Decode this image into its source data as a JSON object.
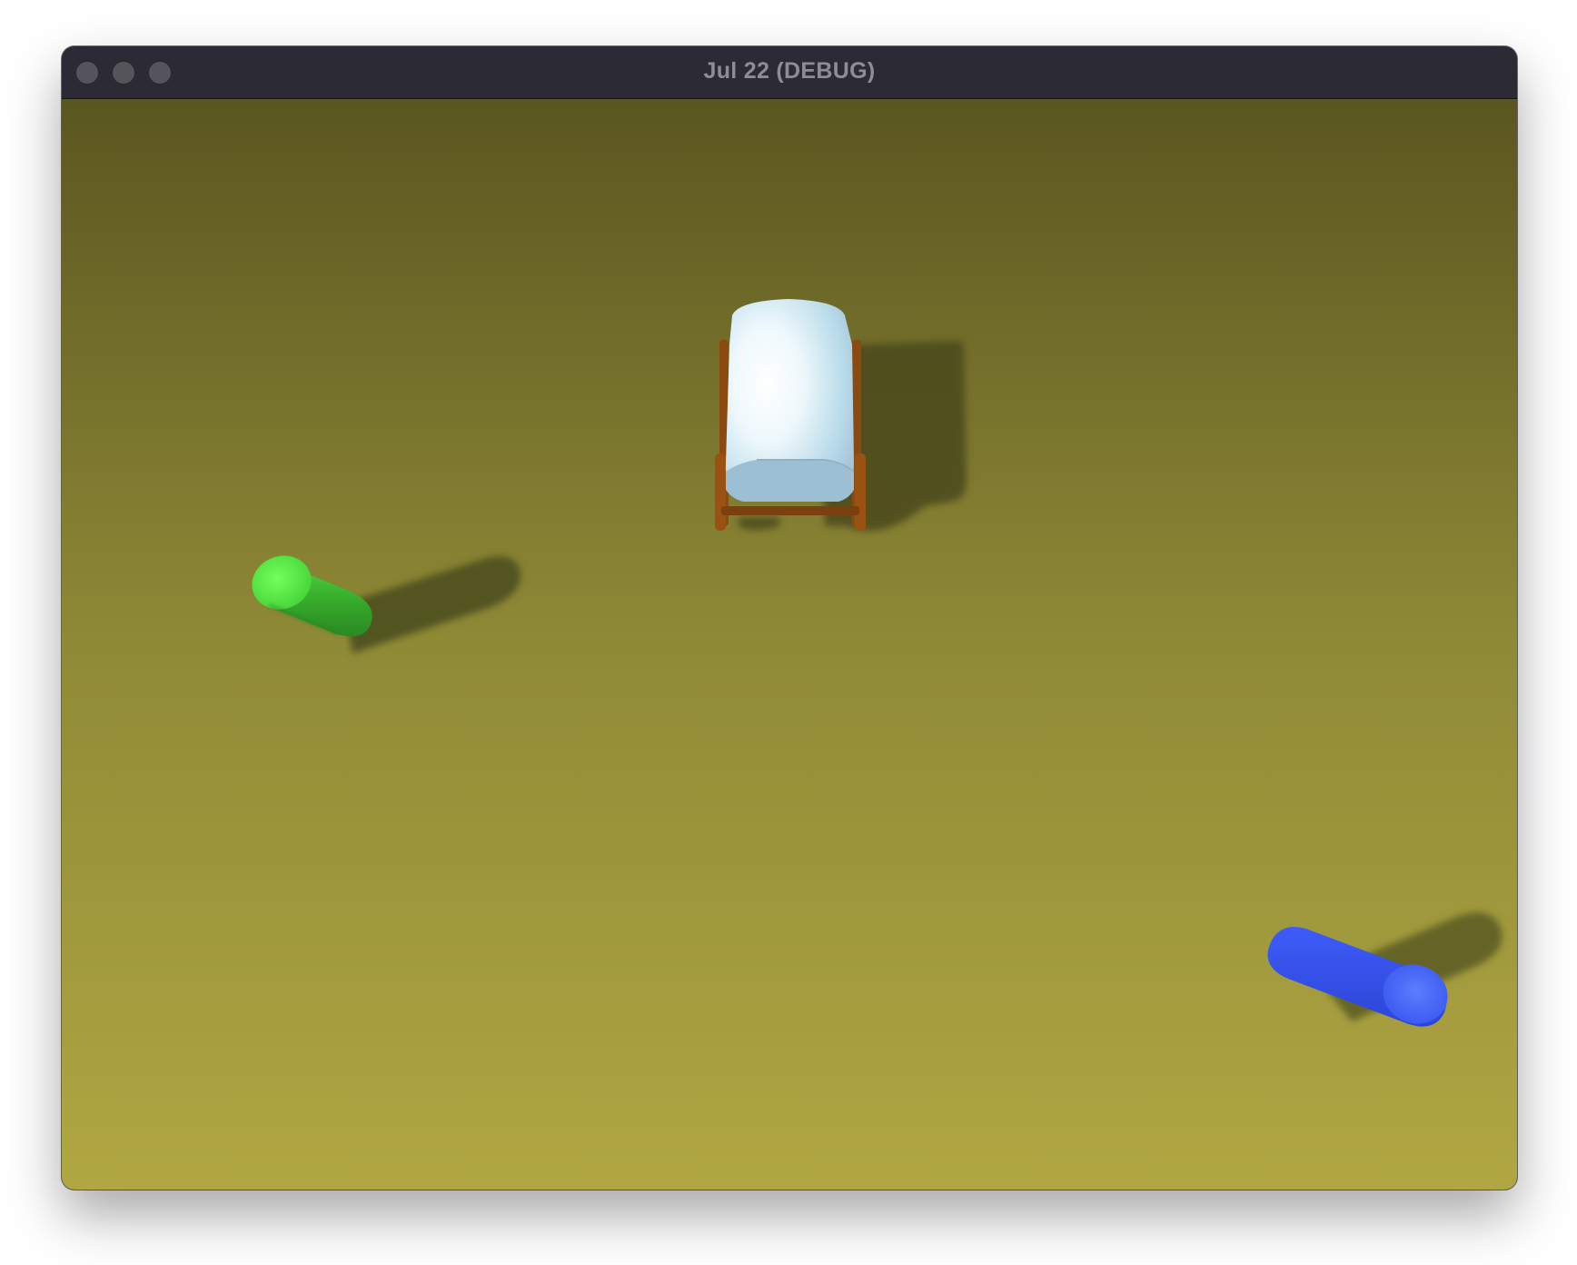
{
  "window": {
    "title": "Jul 22 (DEBUG)"
  },
  "scene": {
    "ground_colors": {
      "top": "#5a5620",
      "bottom": "#b0a742"
    },
    "objects": [
      {
        "name": "covered-wagon",
        "canopy_color": "#c8e6f3",
        "frame_color": "#8a4a12"
      },
      {
        "name": "green-capsule",
        "color": "#3cb82e"
      },
      {
        "name": "blue-capsule",
        "color": "#3a55ee"
      }
    ],
    "shadow_color": "#4a4a1f"
  }
}
